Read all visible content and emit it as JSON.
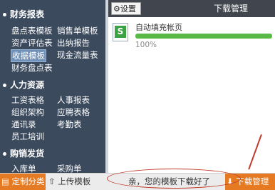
{
  "sidebar": {
    "sections": [
      {
        "title": "财务报表",
        "items": [
          "盘点表模板",
          "销售单模板",
          "资产评估表",
          "出纳报告",
          "收据模板",
          "现金流量表",
          "财务盘点表"
        ]
      },
      {
        "title": "人力资源",
        "items": [
          "工资表格",
          "人事报表",
          "组织架构",
          "应聘表格",
          "通讯录",
          "考勤表",
          "员工培训"
        ]
      },
      {
        "title": "购销发货",
        "items": [
          "入库单",
          "采购单"
        ]
      }
    ]
  },
  "bottom": {
    "custom_label": "定制分类",
    "upload_label": "上传模板",
    "notice": "亲，您的模板下载好了",
    "download_label": "下载管理"
  },
  "panel": {
    "settings_label": "设置",
    "title": "下载管理",
    "file_name": "自动填充帐页",
    "progress_text": "100%",
    "progress_value": 1.0
  },
  "colors": {
    "sidebar_bg": "#3b4a5d",
    "accent_orange": "#e67a22",
    "progress_green": "#58b947",
    "highlight_red": "#c0392b"
  }
}
